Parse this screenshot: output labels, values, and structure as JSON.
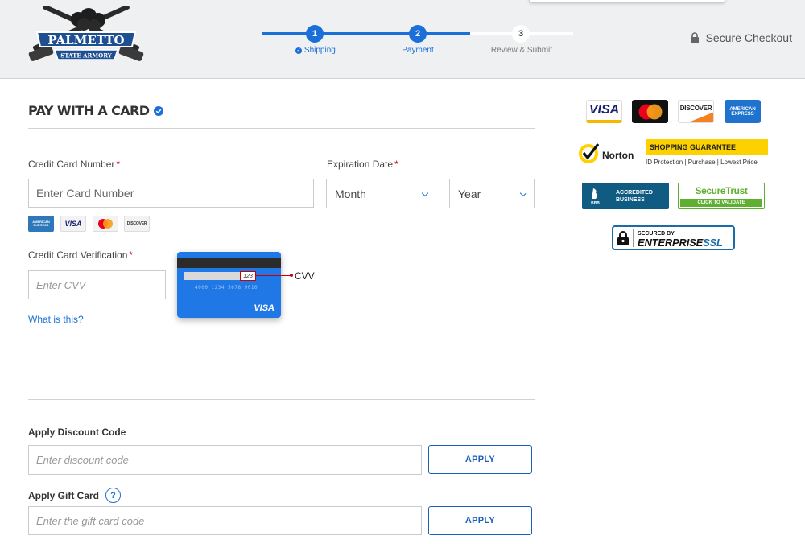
{
  "header": {
    "logo": {
      "top_text": "PALMETTO",
      "bottom_text": "STATE ARMORY"
    },
    "steps": [
      {
        "number": "1",
        "label": "Shipping",
        "state": "complete"
      },
      {
        "number": "2",
        "label": "Payment",
        "state": "active"
      },
      {
        "number": "3",
        "label": "Review & Submit",
        "state": "pending"
      }
    ],
    "secure_checkout": "Secure Checkout"
  },
  "payment": {
    "title": "PAY WITH A CARD",
    "card_number_label": "Credit Card Number",
    "card_number_placeholder": "Enter Card Number",
    "expiration_label": "Expiration Date",
    "month_value": "Month",
    "year_value": "Year",
    "accepted_cards": [
      "AMERICAN EXPRESS",
      "VISA",
      "MASTERCARD",
      "DISCOVER"
    ],
    "cvv_label": "Credit Card Verification",
    "cvv_placeholder": "Enter CVV",
    "what_is_this": "What is this?",
    "cvv_diagram": {
      "cvv_digits": "123",
      "card_number": "4000 1234 5678 9010",
      "brand": "VISA",
      "callout": "CVV"
    },
    "required_marker": "*"
  },
  "discount": {
    "label": "Apply Discount Code",
    "placeholder": "Enter discount code",
    "button": "APPLY"
  },
  "gift_card": {
    "label": "Apply Gift Card",
    "help_icon": "?",
    "placeholder": "Enter the gift card code",
    "button": "APPLY"
  },
  "trust": {
    "cards": [
      "VISA",
      "MASTERCARD",
      "DISCOVER",
      "AMERICAN EXPRESS"
    ],
    "norton": {
      "name": "Norton",
      "headline": "SHOPPING GUARANTEE",
      "sub": "ID Protection | Purchase | Lowest Price"
    },
    "bbb": {
      "logo": "BBB",
      "line1": "ACCREDITED",
      "line2": "BUSINESS"
    },
    "securetrust": {
      "name": "SecureTrust",
      "cta": "CLICK TO VALIDATE"
    },
    "enterprise_ssl": {
      "line1": "SECURED BY",
      "line2": "ENTERPRISE",
      "line3": "SSL"
    }
  },
  "colors": {
    "accent": "#1b6fd8",
    "required": "#d0021b",
    "norton_yellow": "#fdd000",
    "bbb_blue": "#0f5b82",
    "securetrust_green": "#5fb030"
  }
}
